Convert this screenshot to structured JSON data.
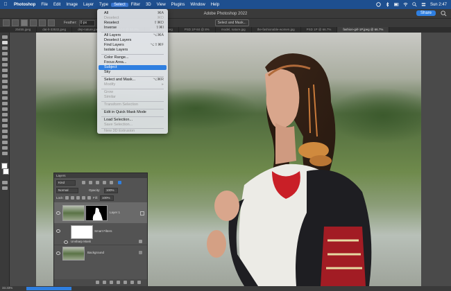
{
  "menubar": {
    "app_name": "Photoshop",
    "items": [
      "File",
      "Edit",
      "Image",
      "Layer",
      "Type",
      "Select",
      "Filter",
      "3D",
      "View",
      "Plugins",
      "Window",
      "Help"
    ],
    "active_item": "Select",
    "clock": "Sun 2:47"
  },
  "window": {
    "title": "Adobe Photoshop 2022",
    "share_label": "Share"
  },
  "options_bar": {
    "feather_label": "Feather:",
    "feather_value": "0 px",
    "select_mask_label": "Select and Mask..."
  },
  "tabs": [
    {
      "label": "25455.jpeg",
      "active": false
    },
    {
      "label": "dat-lt-33532.jpeg",
      "active": false
    },
    {
      "label": "dep-nature.jpeg",
      "active": false
    },
    {
      "label": "Untitled-1 @ 33.3%",
      "active": false
    },
    {
      "label": "ERP-57-86.jpeg",
      "active": false
    },
    {
      "label": "PSD 1P-84 @ 8%",
      "active": false
    },
    {
      "label": "model, nature.jpg",
      "active": false
    },
    {
      "label": "the-fashionable-women.jpg",
      "active": false
    },
    {
      "label": "PSD 1P @ 66.7%",
      "active": false
    },
    {
      "label": "fashion-girl-1P.jpeg @ 66.7%",
      "active": true
    }
  ],
  "select_menu": {
    "items": [
      {
        "label": "All",
        "shortcut": "⌘A",
        "enabled": true
      },
      {
        "label": "Deselect",
        "shortcut": "⌘D",
        "enabled": true
      },
      {
        "label": "Reselect",
        "shortcut": "⇧⌘D",
        "enabled": true
      },
      {
        "label": "Inverse",
        "shortcut": "⇧⌘I",
        "enabled": true
      },
      {
        "sep": true
      },
      {
        "label": "All Layers",
        "shortcut": "⌥⌘A",
        "enabled": true
      },
      {
        "label": "Deselect Layers",
        "shortcut": "",
        "enabled": true
      },
      {
        "label": "Find Layers",
        "shortcut": "⌥⇧⌘F",
        "enabled": true
      },
      {
        "label": "Isolate Layers",
        "shortcut": "",
        "enabled": true
      },
      {
        "sep": true
      },
      {
        "label": "Color Range...",
        "shortcut": "",
        "enabled": true
      },
      {
        "label": "Focus Area...",
        "shortcut": "",
        "enabled": true
      },
      {
        "label": "Subject",
        "shortcut": "",
        "enabled": true,
        "highlighted": true
      },
      {
        "label": "Sky",
        "shortcut": "",
        "enabled": true
      },
      {
        "sep": true
      },
      {
        "label": "Select and Mask...",
        "shortcut": "⌥⌘R",
        "enabled": true
      },
      {
        "label": "Modify",
        "shortcut": "▸",
        "enabled": false
      },
      {
        "sep": true
      },
      {
        "label": "Grow",
        "shortcut": "",
        "enabled": false
      },
      {
        "label": "Similar",
        "shortcut": "",
        "enabled": false
      },
      {
        "sep": true
      },
      {
        "label": "Transform Selection",
        "shortcut": "",
        "enabled": false
      },
      {
        "sep": true
      },
      {
        "label": "Edit in Quick Mask Mode",
        "shortcut": "",
        "enabled": true
      },
      {
        "sep": true
      },
      {
        "label": "Load Selection...",
        "shortcut": "",
        "enabled": true
      },
      {
        "label": "Save Selection...",
        "shortcut": "",
        "enabled": false
      },
      {
        "sep": true
      },
      {
        "label": "New 3D Extrusion",
        "shortcut": "",
        "enabled": false
      }
    ]
  },
  "layers_panel": {
    "title": "Layers",
    "kind_label": "Kind",
    "blend_mode": "Normal",
    "opacity_label": "Opacity:",
    "opacity_value": "100%",
    "lock_label": "Lock:",
    "fill_label": "Fill:",
    "fill_value": "100%",
    "layers": [
      {
        "name": "Layer 1",
        "selected": true,
        "has_mask": true
      },
      {
        "name": "Smart Filters",
        "selected": false,
        "sub": true
      },
      {
        "name": "Unsharp Mask",
        "selected": false,
        "sub": true
      },
      {
        "name": "Background",
        "selected": false
      }
    ]
  },
  "status": {
    "zoom": "33.33%"
  }
}
